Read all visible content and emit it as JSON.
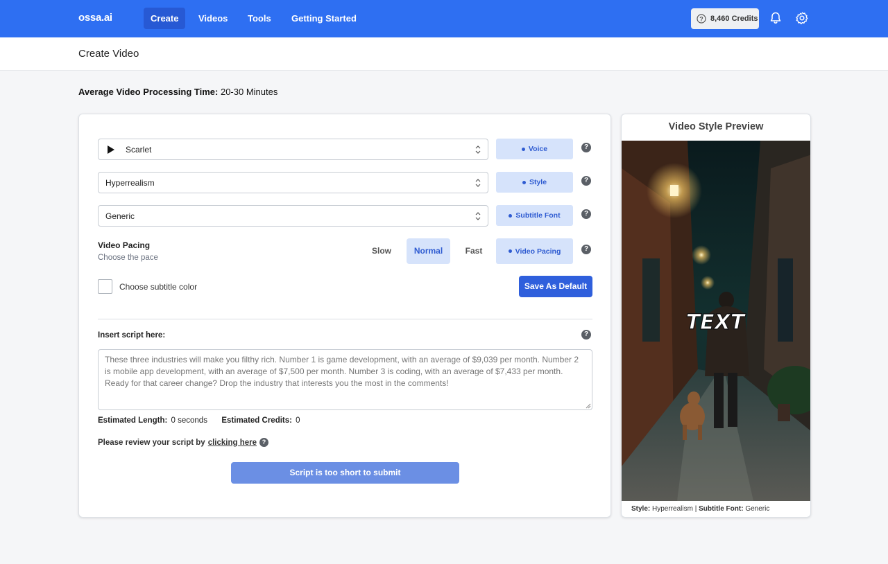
{
  "nav": {
    "logo": "ossa.ai",
    "links": [
      "Create",
      "Videos",
      "Tools",
      "Getting Started"
    ],
    "credits": "8,460 Credits"
  },
  "page": {
    "title": "Create Video",
    "avg_label": "Average Video Processing Time:",
    "avg_value": "20-30 Minutes"
  },
  "form": {
    "voice": {
      "value": "Scarlet",
      "tag": "Voice"
    },
    "style": {
      "value": "Hyperrealism",
      "tag": "Style"
    },
    "font": {
      "value": "Generic",
      "tag": "Subtitle Font"
    },
    "pacing": {
      "title": "Video Pacing",
      "subtitle": "Choose the pace",
      "options": [
        "Slow",
        "Normal",
        "Fast"
      ],
      "selected": "Normal",
      "tag": "Video Pacing"
    },
    "subtitle_color_label": "Choose subtitle color",
    "save_default": "Save As Default",
    "help": "?"
  },
  "script": {
    "label": "Insert script here:",
    "placeholder": "These three industries will make you filthy rich. Number 1 is game development, with an average of $9,039 per month. Number 2 is mobile app development, with an average of $7,500 per month. Number 3 is coding, with an average of $7,433 per month. Ready for that career change? Drop the industry that interests you the most in the comments!",
    "est_length_label": "Estimated Length:",
    "est_length_value": "0 seconds",
    "est_credits_label": "Estimated Credits:",
    "est_credits_value": "0",
    "review_prefix": "Please review your script by",
    "review_link": "clicking here",
    "submit": "Script is too short to submit"
  },
  "preview": {
    "title": "Video Style Preview",
    "overlay_text": "TEXT",
    "style_label": "Style:",
    "style_value": "Hyperrealism",
    "sep": "|",
    "font_label": "Subtitle Font:",
    "font_value": "Generic"
  },
  "colors": {
    "nav_bg": "#2e6ff2",
    "accent": "#2f5fdc",
    "tag_bg": "#d6e3fb",
    "submit_disabled": "#6b8fe4"
  }
}
